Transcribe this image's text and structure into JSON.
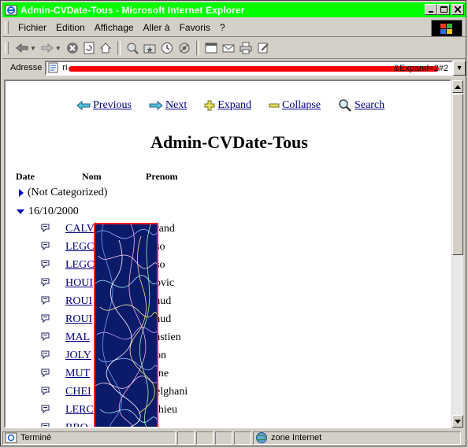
{
  "window": {
    "title": "Admin-CVDate-Tous - Microsoft Internet Explorer"
  },
  "menu": {
    "items": [
      "Fichier",
      "Edition",
      "Affichage",
      "Aller à",
      "Favoris",
      "?"
    ]
  },
  "address": {
    "label": "Adresse",
    "url_start": "ri",
    "url_end": "&Expand=2#2"
  },
  "nav": {
    "previous": "Previous",
    "next": "Next",
    "expand": "Expand",
    "collapse": "Collapse",
    "search": "Search"
  },
  "page": {
    "title": "Admin-CVDate-Tous",
    "columns": [
      "Date",
      "Nom",
      "Prenom"
    ]
  },
  "categories": [
    {
      "label": "(Not Categorized)",
      "expanded": false
    },
    {
      "label": "16/10/2000",
      "expanded": true
    }
  ],
  "rows": [
    {
      "nom": "CALV",
      "prenom": "rand"
    },
    {
      "nom": "LEGC",
      "prenom": "so"
    },
    {
      "nom": "LEGC",
      "prenom": "so"
    },
    {
      "nom": "HOUI",
      "prenom": "ovic"
    },
    {
      "nom": "ROUI",
      "prenom": "aud"
    },
    {
      "nom": "ROUI",
      "prenom": "aud"
    },
    {
      "nom": "MAL",
      "prenom": "astien"
    },
    {
      "nom": "JOLY",
      "prenom": "on"
    },
    {
      "nom": "MUT",
      "prenom": "ine"
    },
    {
      "nom": "CHEI",
      "prenom": "elghani"
    },
    {
      "nom": "LERC",
      "prenom": "thieu"
    },
    {
      "nom": "BRO",
      "prenom": ""
    }
  ],
  "status": {
    "text": "Terminé",
    "zone": "zone Internet"
  },
  "colors": {
    "titlebar": "#00ff00",
    "link": "#000080",
    "redaction": "#ff0000"
  }
}
